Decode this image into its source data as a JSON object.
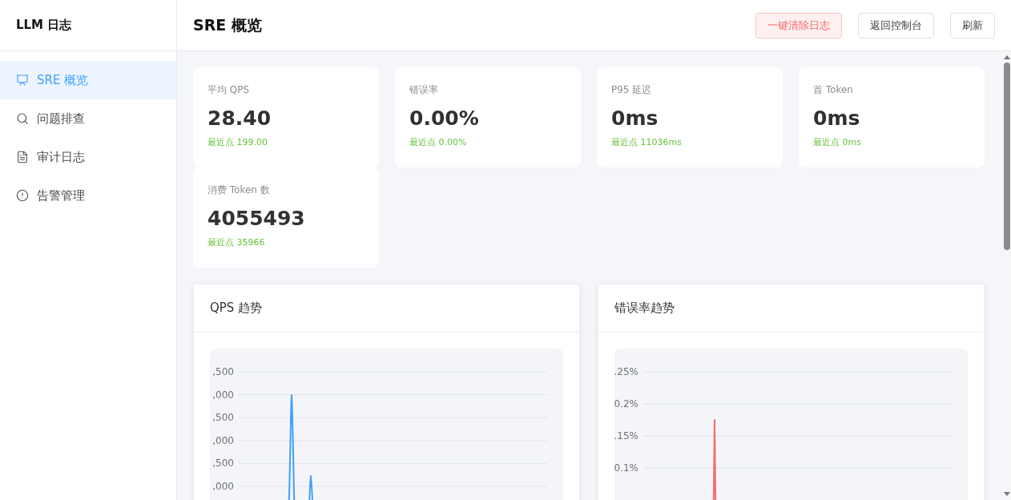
{
  "sidebar": {
    "title": "LLM 日志",
    "items": [
      {
        "label": "SRE 概览",
        "selected": true
      },
      {
        "label": "问题排查",
        "selected": false
      },
      {
        "label": "审计日志",
        "selected": false
      },
      {
        "label": "告警管理",
        "selected": false
      }
    ]
  },
  "header": {
    "title": "SRE 概览",
    "buttons": [
      {
        "label": "一键清除日志",
        "kind": "danger"
      },
      {
        "label": "返回控制台",
        "kind": "default"
      },
      {
        "label": "刷新",
        "kind": "default"
      }
    ]
  },
  "stats": [
    {
      "label": "平均 QPS",
      "value": "28.40",
      "recent": "最近点 199.00"
    },
    {
      "label": "错误率",
      "value": "0.00%",
      "recent": "最近点 0.00%"
    },
    {
      "label": "P95 延迟",
      "value": "0ms",
      "recent": "最近点 11036ms"
    },
    {
      "label": "首 Token",
      "value": "0ms",
      "recent": "最近点 0ms"
    },
    {
      "label": "消费 Token 数",
      "value": "4055493",
      "recent": "最近点 35966"
    }
  ],
  "charts": [
    {
      "title": "QPS 趋势",
      "axis_labels": [
        ",500",
        ",000",
        ",500",
        ",000",
        ",500",
        ",000"
      ]
    },
    {
      "title": "错误率趋势",
      "axis_labels": [
        ".25%",
        "0.2%",
        ".15%",
        "0.1%"
      ]
    }
  ]
}
